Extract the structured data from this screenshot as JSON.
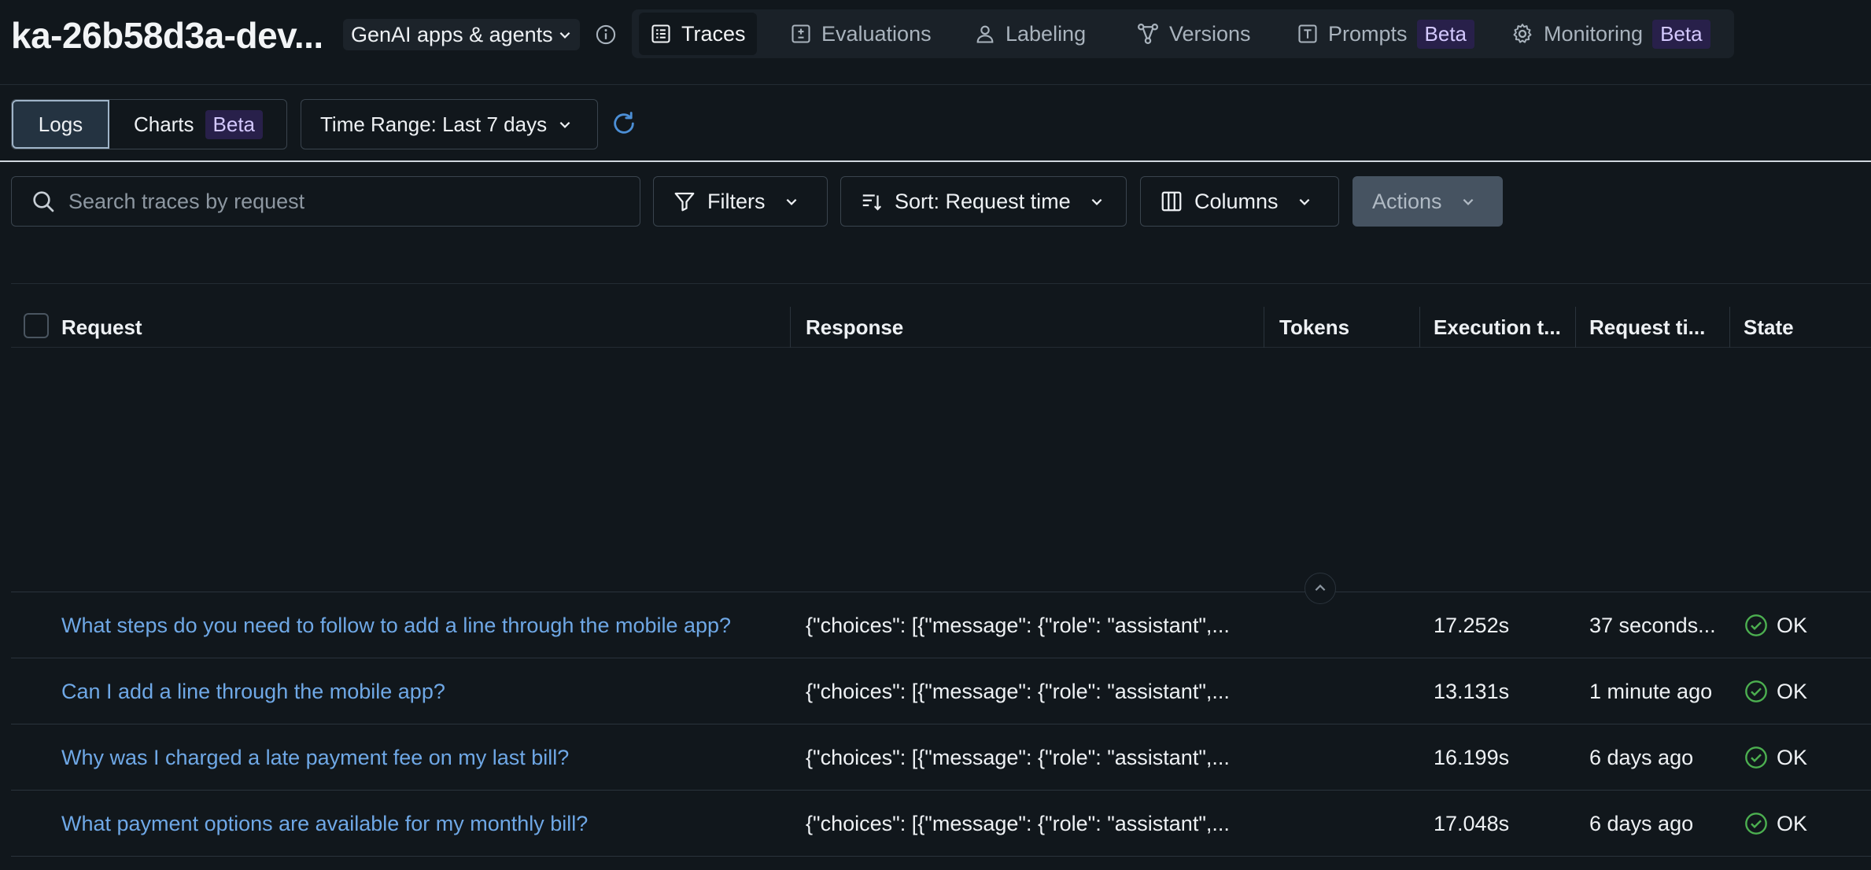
{
  "header": {
    "app_title": "ka-26b58d3a-dev...",
    "type_dropdown": "GenAI apps & agents",
    "tabs": [
      {
        "label": "Traces",
        "icon": "list-icon",
        "active": true,
        "badge": ""
      },
      {
        "label": "Evaluations",
        "icon": "plus-minus-icon",
        "active": false,
        "badge": ""
      },
      {
        "label": "Labeling",
        "icon": "user-icon",
        "active": false,
        "badge": ""
      },
      {
        "label": "Versions",
        "icon": "branch-icon",
        "active": false,
        "badge": ""
      },
      {
        "label": "Prompts",
        "icon": "text-box-icon",
        "active": false,
        "badge": "Beta"
      },
      {
        "label": "Monitoring",
        "icon": "gear-icon",
        "active": false,
        "badge": "Beta"
      }
    ]
  },
  "view_toggle": {
    "logs": "Logs",
    "charts": "Charts",
    "charts_badge": "Beta"
  },
  "time_range": "Time Range: Last 7 days",
  "toolbar": {
    "search_placeholder": "Search traces by request",
    "filters": "Filters",
    "sort": "Sort: Request time",
    "columns": "Columns",
    "actions": "Actions"
  },
  "table": {
    "columns": [
      "Request",
      "Response",
      "Tokens",
      "Execution t...",
      "Request ti...",
      "State"
    ],
    "rows": [
      {
        "request": "What steps do you need to follow to add a line through the mobile app?",
        "response": "{\"choices\": [{\"message\": {\"role\": \"assistant\",...",
        "tokens": "",
        "execution_time": "17.252s",
        "request_time": "37 seconds...",
        "state": "OK"
      },
      {
        "request": "Can I add a line through the mobile app?",
        "response": "{\"choices\": [{\"message\": {\"role\": \"assistant\",...",
        "tokens": "",
        "execution_time": "13.131s",
        "request_time": "1 minute ago",
        "state": "OK"
      },
      {
        "request": "Why was I charged a late payment fee on my last bill?",
        "response": "{\"choices\": [{\"message\": {\"role\": \"assistant\",...",
        "tokens": "",
        "execution_time": "16.199s",
        "request_time": "6 days ago",
        "state": "OK"
      },
      {
        "request": "What payment options are available for my monthly bill?",
        "response": "{\"choices\": [{\"message\": {\"role\": \"assistant\",...",
        "tokens": "",
        "execution_time": "17.048s",
        "request_time": "6 days ago",
        "state": "OK"
      }
    ]
  },
  "colors": {
    "background": "#11171c",
    "link": "#6fa8e6",
    "ok": "#4caf50",
    "beta_bg": "#28204a",
    "refresh": "#4c8fd6"
  }
}
